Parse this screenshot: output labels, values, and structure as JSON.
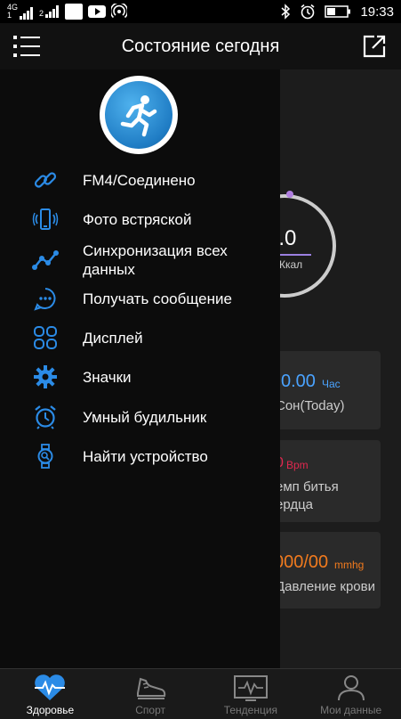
{
  "status_bar": {
    "network_top": "4G",
    "network_bottom": "1",
    "network2_top": "",
    "network2_bottom": "2",
    "time": "19:33"
  },
  "header": {
    "title": "Состояние сегодня"
  },
  "background": {
    "calories_value": "0.0",
    "calories_unit": "Ккал",
    "sleep_value": "0.00",
    "sleep_unit": "Час",
    "sleep_label": "Сон(Today)",
    "heart_value": "0",
    "heart_unit": "Bpm",
    "heart_label_1": "емп битья",
    "heart_label_2": "ердца",
    "bp_value": "000/00",
    "bp_unit": "mmhg",
    "bp_label": "Давление крови"
  },
  "drawer": {
    "items": [
      {
        "label": "FM4/Соединено",
        "icon": "link-icon"
      },
      {
        "label": "Фото встряской",
        "icon": "shake-phone-icon"
      },
      {
        "label": "Синхронизация всех\nданных",
        "icon": "sync-data-icon"
      },
      {
        "label": "Получать сообщение",
        "icon": "message-icon"
      },
      {
        "label": "Дисплей",
        "icon": "display-icon"
      },
      {
        "label": "Значки",
        "icon": "gear-icon"
      },
      {
        "label": "Умный будильник",
        "icon": "alarm-clock-icon"
      },
      {
        "label": "Найти устройство",
        "icon": "find-device-icon"
      }
    ]
  },
  "bottom_nav": [
    {
      "label": "Здоровье",
      "icon": "heart-icon",
      "active": true
    },
    {
      "label": "Спорт",
      "icon": "sneaker-icon",
      "active": false
    },
    {
      "label": "Тенденция",
      "icon": "trend-icon",
      "active": false
    },
    {
      "label": "Мои данные",
      "icon": "person-icon",
      "active": false
    }
  ],
  "colors": {
    "accent": "#2b8be6",
    "heart_rate": "#e0284f",
    "blood_pressure": "#f07a1e",
    "sleep": "#4aa3ff",
    "calorie_ring": "#9b7fe0"
  }
}
